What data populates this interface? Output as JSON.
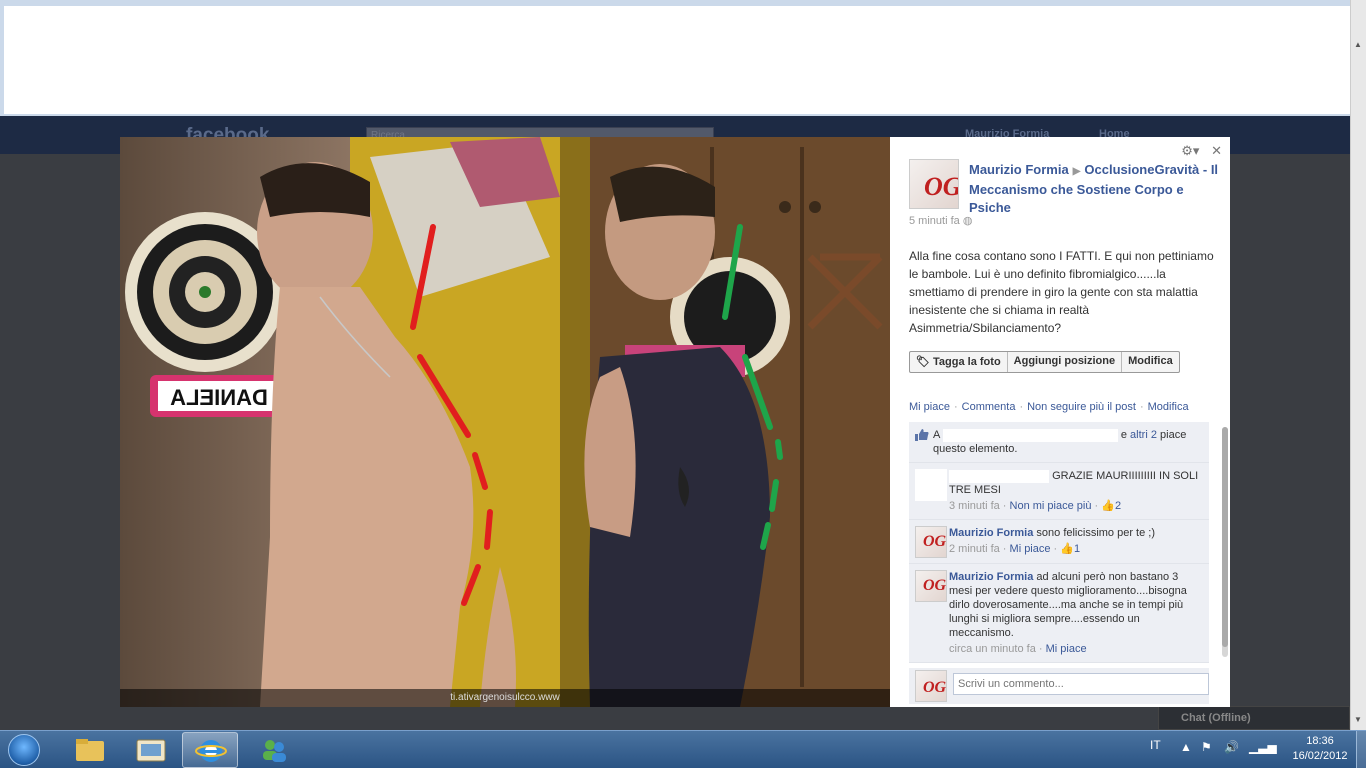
{
  "facebook_bg": {
    "logo": "facebook",
    "search_placeholder": "Ricerca",
    "user_name": "Maurizio Formia",
    "home_link": "Home",
    "chat_label": "Chat (Offline)"
  },
  "photo": {
    "caption": "ti.ativargenoisulcco.www",
    "sign_text": "DANIELA"
  },
  "post": {
    "author": "Maurizio Formia",
    "page": "OcclusioneGravità - Il Meccanismo che Sostiene Corpo e Psiche",
    "time": "5 minuti fa",
    "text": "Alla fine cosa contano sono I FATTI. E qui non pettiniamo le bambole. Lui è uno definito fibromialgico......la smettiamo di prendere in giro la gente con sta malattia inesistente che si chiama in realtà Asimmetria/Sbilanciamento?",
    "tag_buttons": [
      "Tagga la foto",
      "Aggiungi posizione",
      "Modifica"
    ],
    "actions": [
      "Mi piace",
      "Commenta",
      "Non seguire più il post",
      "Modifica"
    ]
  },
  "likes": {
    "prefix": "A",
    "others": "altri 2",
    "and": "e",
    "suffix": "piace questo elemento."
  },
  "comments": [
    {
      "author": "",
      "text": "GRAZIE MAURIIIIIIIII IN SOLI TRE MESI",
      "time": "3 minuti fa",
      "like_action": "Non mi piace più",
      "likes": "2"
    },
    {
      "author": "Maurizio Formia",
      "text": "sono felicissimo per te ;)",
      "time": "2 minuti fa",
      "like_action": "Mi piace",
      "likes": "1"
    },
    {
      "author": "Maurizio Formia",
      "text": "ad alcuni però non bastano 3 mesi per vedere questo miglioramento....bisogna dirlo doverosamente....ma anche se in tempi più lunghi si migliora sempre....essendo un meccanismo.",
      "time": "circa un minuto fa",
      "like_action": "Mi piace",
      "likes": ""
    }
  ],
  "reply": {
    "placeholder": "Scrivi un commento..."
  },
  "avatar_text": "OG",
  "taskbar": {
    "language": "IT",
    "time": "18:36",
    "date": "16/02/2012"
  }
}
